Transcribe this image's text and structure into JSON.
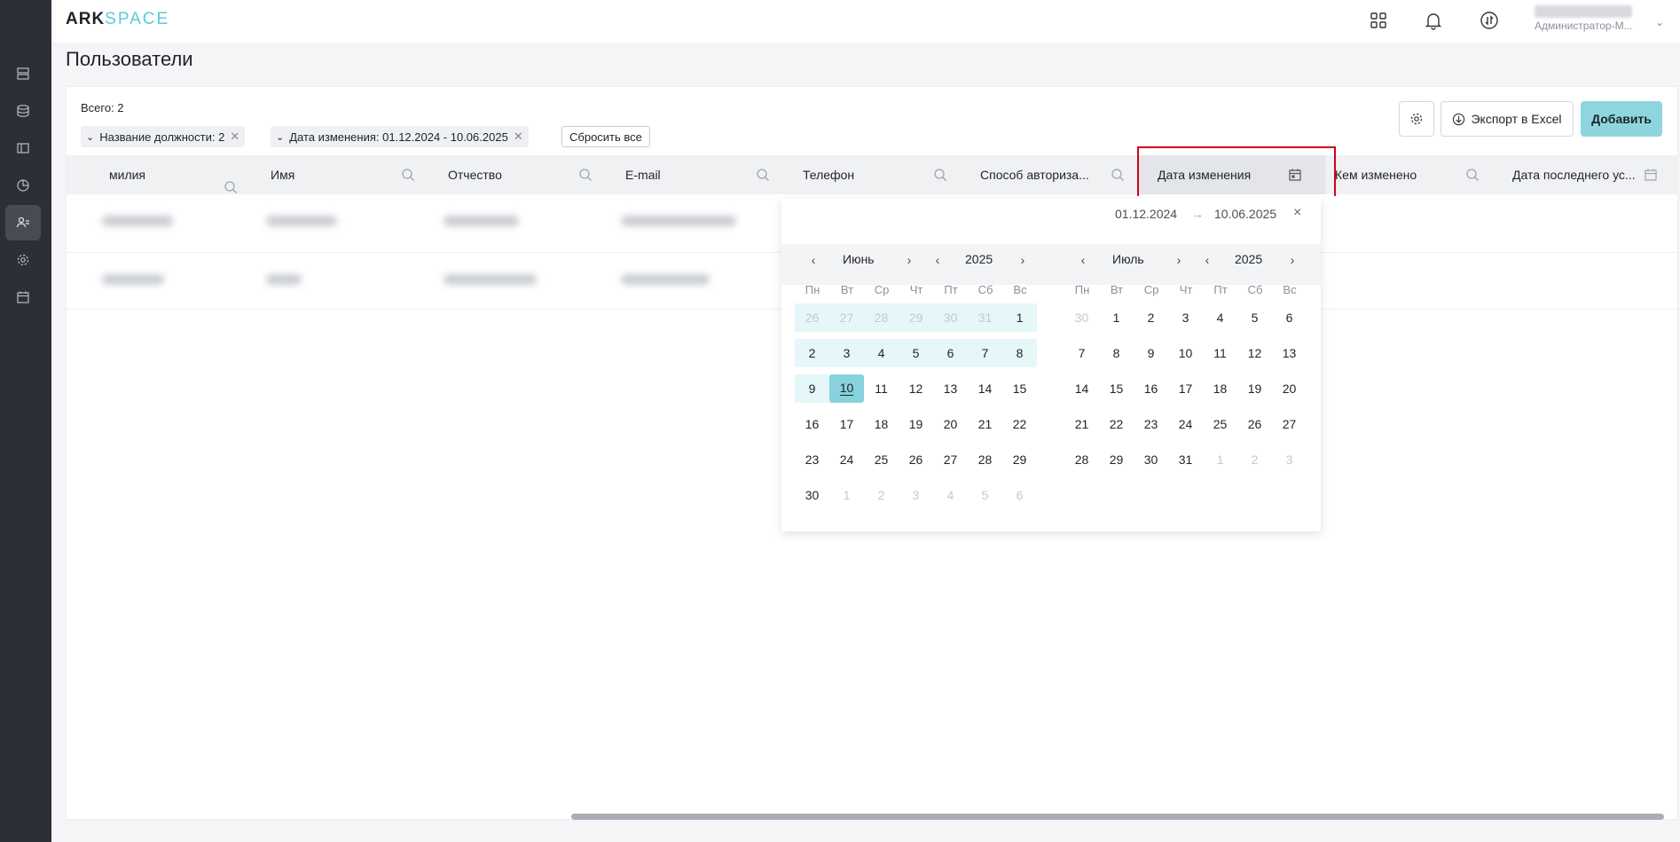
{
  "app": {
    "logo_ark": "ARK",
    "logo_space": "SPACE",
    "user_name": "Администратор-М..."
  },
  "page": {
    "title": "Пользователи",
    "total": "Всего: 2"
  },
  "filters": [
    {
      "label": "Название должности: 2"
    },
    {
      "label": "Дата изменения: 01.12.2024 - 10.06.2025"
    }
  ],
  "toolbar": {
    "reset_label": "Сбросить все",
    "export_label": "Экспорт в Excel",
    "add_label": "Добавить"
  },
  "table": {
    "columns": [
      "милия",
      "Имя",
      "Отчество",
      "E-mail",
      "Телефон",
      "Способ авториза...",
      "Дата изменения",
      "Кем изменено",
      "Дата последнего ус..."
    ]
  },
  "datepicker": {
    "start": "01.12.2024",
    "end": "10.06.2025",
    "arrow": "→",
    "clear": "×",
    "weekdays": [
      "Пн",
      "Вт",
      "Ср",
      "Чт",
      "Пт",
      "Сб",
      "Вс"
    ],
    "left": {
      "month": "Июнь",
      "year": "2025",
      "weeks": [
        [
          "26",
          "27",
          "28",
          "29",
          "30",
          "31",
          "1"
        ],
        [
          "2",
          "3",
          "4",
          "5",
          "6",
          "7",
          "8"
        ],
        [
          "9",
          "10",
          "11",
          "12",
          "13",
          "14",
          "15"
        ],
        [
          "16",
          "17",
          "18",
          "19",
          "20",
          "21",
          "22"
        ],
        [
          "23",
          "24",
          "25",
          "26",
          "27",
          "28",
          "29"
        ],
        [
          "30",
          "1",
          "2",
          "3",
          "4",
          "5",
          "6"
        ]
      ]
    },
    "right": {
      "month": "Июль",
      "year": "2025",
      "weeks": [
        [
          "30",
          "1",
          "2",
          "3",
          "4",
          "5",
          "6"
        ],
        [
          "7",
          "8",
          "9",
          "10",
          "11",
          "12",
          "13"
        ],
        [
          "14",
          "15",
          "16",
          "17",
          "18",
          "19",
          "20"
        ],
        [
          "21",
          "22",
          "23",
          "24",
          "25",
          "26",
          "27"
        ],
        [
          "28",
          "29",
          "30",
          "31",
          "1",
          "2",
          "3"
        ]
      ]
    }
  },
  "colors": {
    "accent": "#8ed6de",
    "highlight_border": "#d0021b",
    "sidebar": "#2c2f36"
  }
}
